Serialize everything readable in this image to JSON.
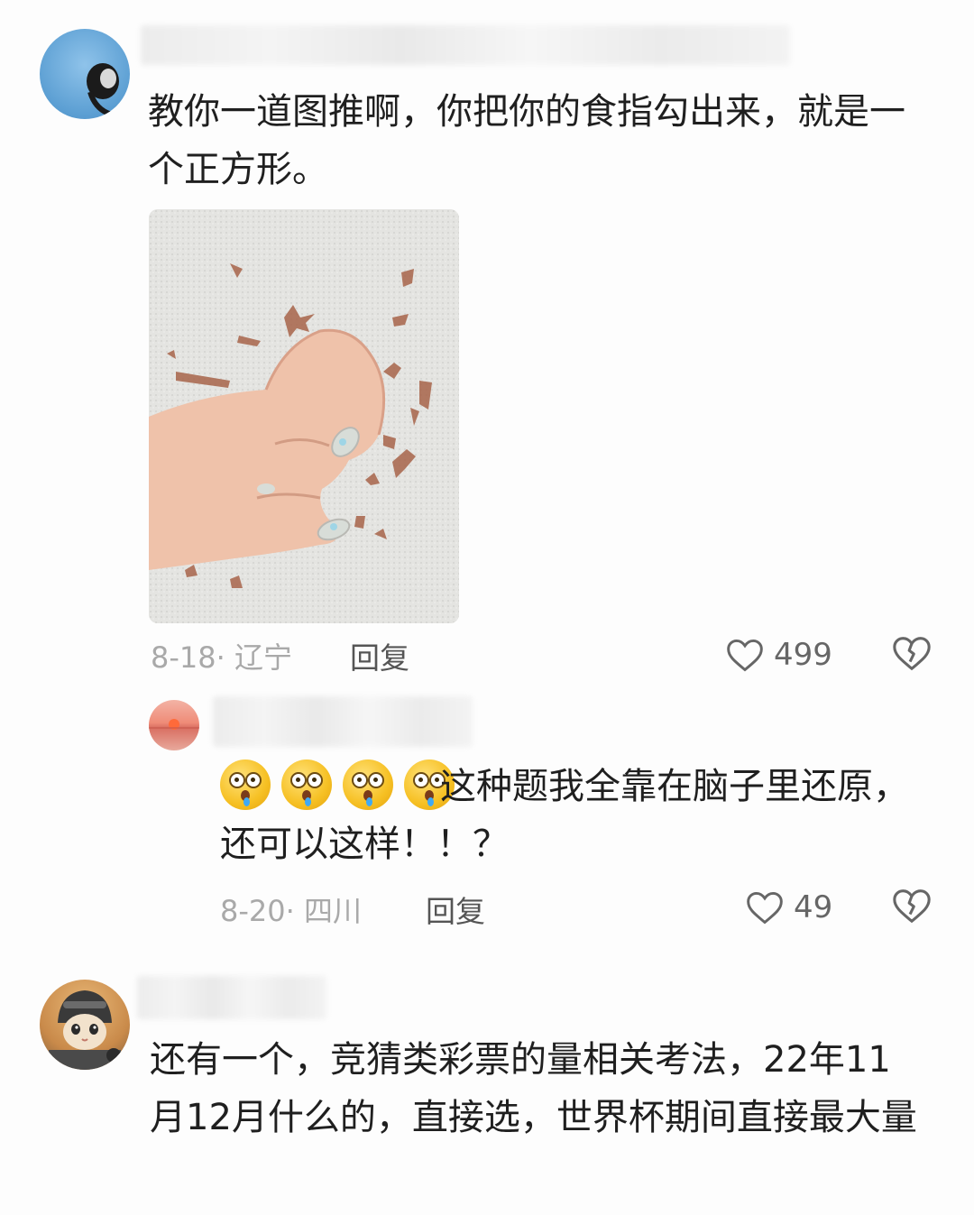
{
  "comments": [
    {
      "text": "教你一道图推啊，你把你的食指勾出来，就是一个正方形。",
      "meta": "8-18· 辽宁",
      "reply_label": "回复",
      "likes": "499",
      "replies": [
        {
          "emoji_count": 4,
          "text": "这种题我全靠在脑子里还原，还可以这样！！？",
          "meta": "8-20· 四川",
          "reply_label": "回复",
          "likes": "49"
        }
      ]
    },
    {
      "text": "还有一个，竞猜类彩票的量相关考法，22年11月12月什么的，直接选，世界杯期间直接最大量"
    }
  ],
  "icons": {
    "like": "heart-outline-icon",
    "dislike": "broken-heart-icon"
  }
}
